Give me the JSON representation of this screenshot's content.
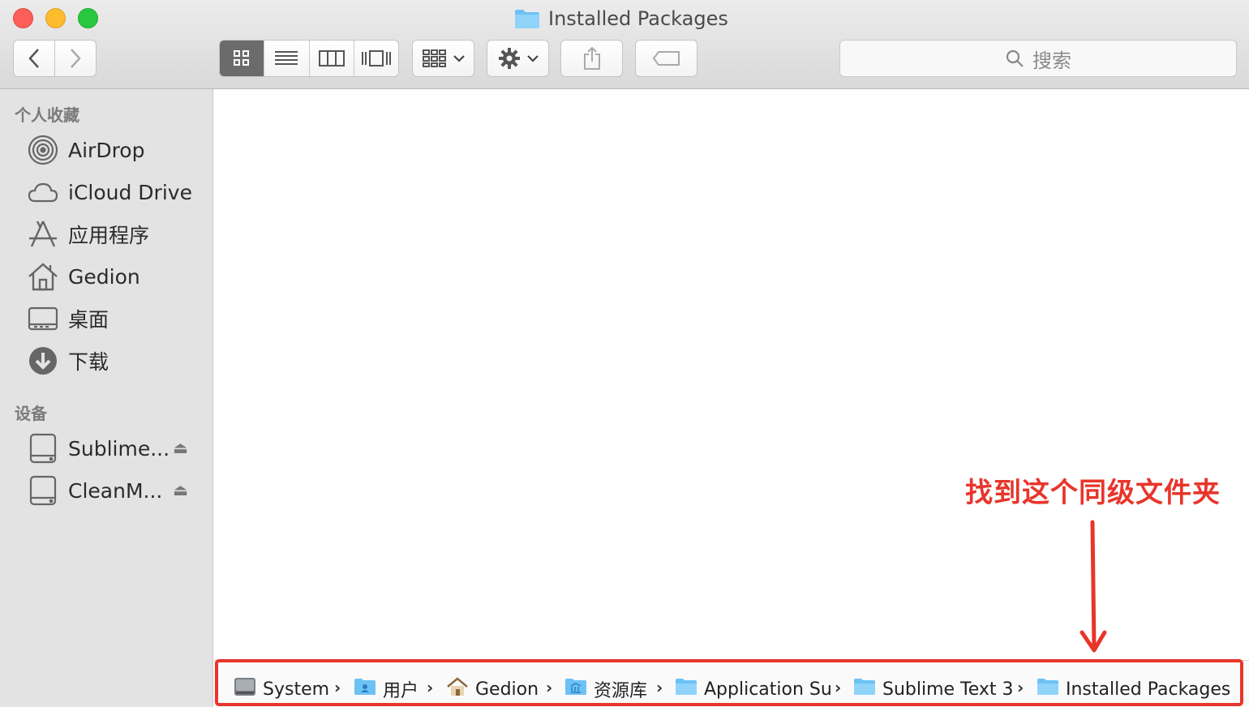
{
  "window": {
    "title": "Installed Packages"
  },
  "toolbar": {
    "back_icon": "chevron-left-icon",
    "forward_icon": "chevron-right-icon",
    "views": [
      "icon-view",
      "list-view",
      "column-view",
      "cover-flow-view"
    ],
    "active_view": "icon-view",
    "search_placeholder": "搜索"
  },
  "sidebar": {
    "favorites_header": "个人收藏",
    "favorites": [
      {
        "label": "AirDrop",
        "icon": "airdrop-icon"
      },
      {
        "label": "iCloud Drive",
        "icon": "cloud-icon"
      },
      {
        "label": "应用程序",
        "icon": "applications-icon"
      },
      {
        "label": "Gedion",
        "icon": "home-icon"
      },
      {
        "label": "桌面",
        "icon": "desktop-icon"
      },
      {
        "label": "下载",
        "icon": "download-icon"
      }
    ],
    "devices_header": "设备",
    "devices": [
      {
        "label": "Sublime...",
        "icon": "disk-icon"
      },
      {
        "label": "CleanM...",
        "icon": "disk-icon"
      }
    ]
  },
  "annotation": {
    "text": "找到这个同级文件夹",
    "color": "#e8352b"
  },
  "pathbar": {
    "items": [
      {
        "label": "System",
        "icon": "hard-drive-icon"
      },
      {
        "label": "用户",
        "icon": "users-folder-icon"
      },
      {
        "label": "Gedion",
        "icon": "home-icon"
      },
      {
        "label": "资源库",
        "icon": "library-folder-icon"
      },
      {
        "label": "Application Su",
        "icon": "folder-icon"
      },
      {
        "label": "Sublime Text 3",
        "icon": "folder-icon"
      },
      {
        "label": "Installed Packages",
        "icon": "folder-icon"
      }
    ]
  }
}
